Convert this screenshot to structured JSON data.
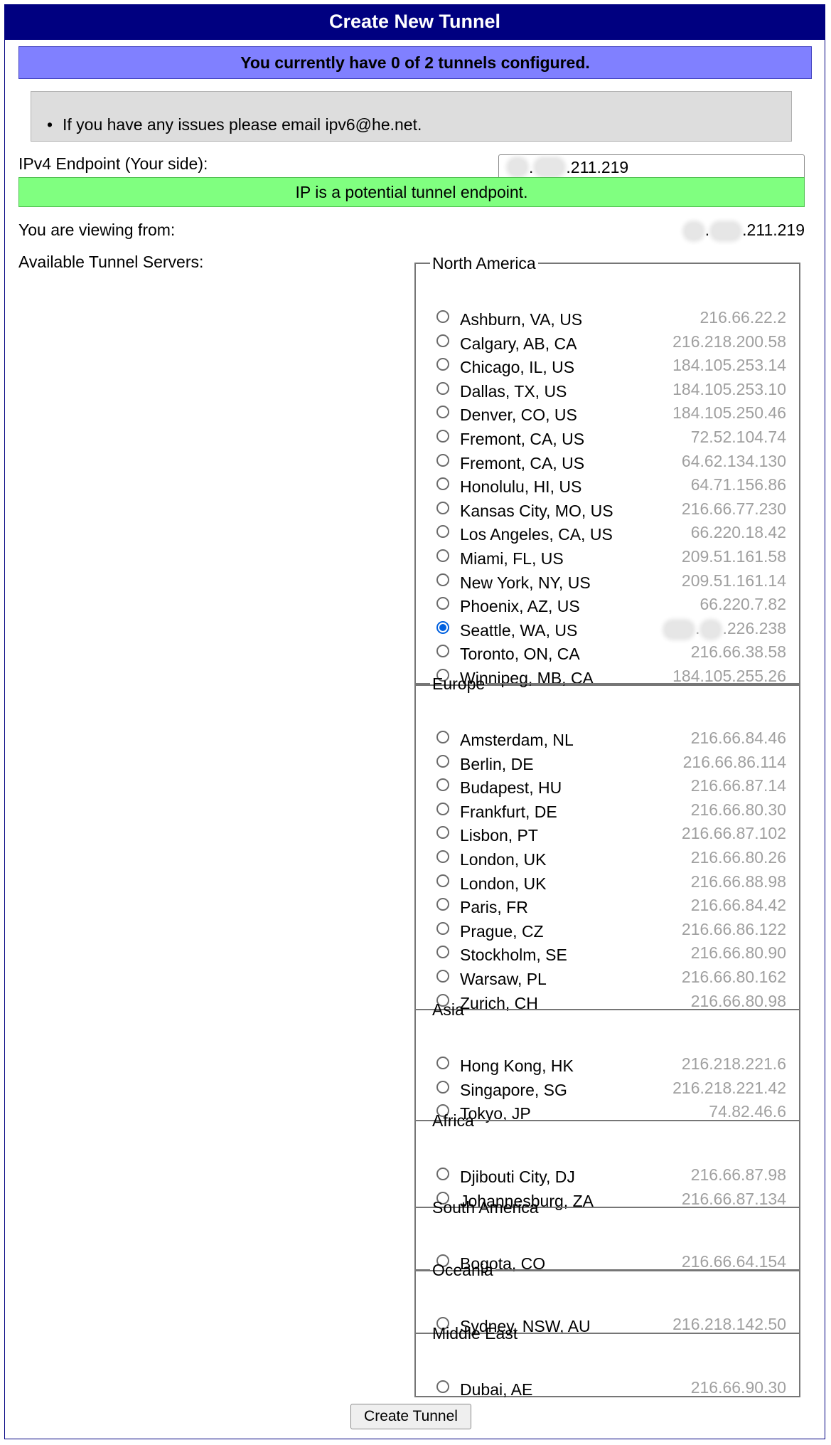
{
  "title": "Create New Tunnel",
  "status": "You currently have 0 of 2 tunnels configured.",
  "notice": "If you have any issues please email ipv6@he.net.",
  "endpoint": {
    "label": "IPv4 Endpoint (Your side):",
    "value": ".211.219",
    "validation": "IP is a potential tunnel endpoint."
  },
  "viewing": {
    "label": "You are viewing from:",
    "ip": ".211.219"
  },
  "servers_label": "Available Tunnel Servers:",
  "regions": [
    {
      "name": "North America",
      "servers": [
        {
          "city": "Ashburn, VA, US",
          "ip": "216.66.22.2"
        },
        {
          "city": "Calgary, AB, CA",
          "ip": "216.218.200.58"
        },
        {
          "city": "Chicago, IL, US",
          "ip": "184.105.253.14"
        },
        {
          "city": "Dallas, TX, US",
          "ip": "184.105.253.10"
        },
        {
          "city": "Denver, CO, US",
          "ip": "184.105.250.46"
        },
        {
          "city": "Fremont, CA, US",
          "ip": "72.52.104.74"
        },
        {
          "city": "Fremont, CA, US",
          "ip": "64.62.134.130"
        },
        {
          "city": "Honolulu, HI, US",
          "ip": "64.71.156.86"
        },
        {
          "city": "Kansas City, MO, US",
          "ip": "216.66.77.230"
        },
        {
          "city": "Los Angeles, CA, US",
          "ip": "66.220.18.42"
        },
        {
          "city": "Miami, FL, US",
          "ip": "209.51.161.58"
        },
        {
          "city": "New York, NY, US",
          "ip": "209.51.161.14"
        },
        {
          "city": "Phoenix, AZ, US",
          "ip": "66.220.7.82"
        },
        {
          "city": "Seattle, WA, US",
          "ip": ".226.238",
          "selected": true,
          "redacted": true
        },
        {
          "city": "Toronto, ON, CA",
          "ip": "216.66.38.58"
        },
        {
          "city": "Winnipeg, MB, CA",
          "ip": "184.105.255.26"
        }
      ]
    },
    {
      "name": "Europe",
      "servers": [
        {
          "city": "Amsterdam, NL",
          "ip": "216.66.84.46"
        },
        {
          "city": "Berlin, DE",
          "ip": "216.66.86.114"
        },
        {
          "city": "Budapest, HU",
          "ip": "216.66.87.14"
        },
        {
          "city": "Frankfurt, DE",
          "ip": "216.66.80.30"
        },
        {
          "city": "Lisbon, PT",
          "ip": "216.66.87.102"
        },
        {
          "city": "London, UK",
          "ip": "216.66.80.26"
        },
        {
          "city": "London, UK",
          "ip": "216.66.88.98"
        },
        {
          "city": "Paris, FR",
          "ip": "216.66.84.42"
        },
        {
          "city": "Prague, CZ",
          "ip": "216.66.86.122"
        },
        {
          "city": "Stockholm, SE",
          "ip": "216.66.80.90"
        },
        {
          "city": "Warsaw, PL",
          "ip": "216.66.80.162"
        },
        {
          "city": "Zurich, CH",
          "ip": "216.66.80.98"
        }
      ]
    },
    {
      "name": "Asia",
      "servers": [
        {
          "city": "Hong Kong, HK",
          "ip": "216.218.221.6"
        },
        {
          "city": "Singapore, SG",
          "ip": "216.218.221.42"
        },
        {
          "city": "Tokyo, JP",
          "ip": "74.82.46.6"
        }
      ]
    },
    {
      "name": "Africa",
      "servers": [
        {
          "city": "Djibouti City, DJ",
          "ip": "216.66.87.98"
        },
        {
          "city": "Johannesburg, ZA",
          "ip": "216.66.87.134"
        }
      ]
    },
    {
      "name": "South America",
      "servers": [
        {
          "city": "Bogota, CO",
          "ip": "216.66.64.154"
        }
      ]
    },
    {
      "name": "Oceania",
      "servers": [
        {
          "city": "Sydney, NSW, AU",
          "ip": "216.218.142.50"
        }
      ]
    },
    {
      "name": "Middle East",
      "servers": [
        {
          "city": "Dubai, AE",
          "ip": "216.66.90.30"
        }
      ]
    }
  ],
  "submit_label": "Create Tunnel",
  "colors": {
    "title_bg": "#000080",
    "status_bg": "#8080ff",
    "notice_bg": "#dddddd",
    "ok_bg": "#80ff80",
    "server_ip": "#a0a0a0",
    "radio_checked": "#0060df"
  }
}
